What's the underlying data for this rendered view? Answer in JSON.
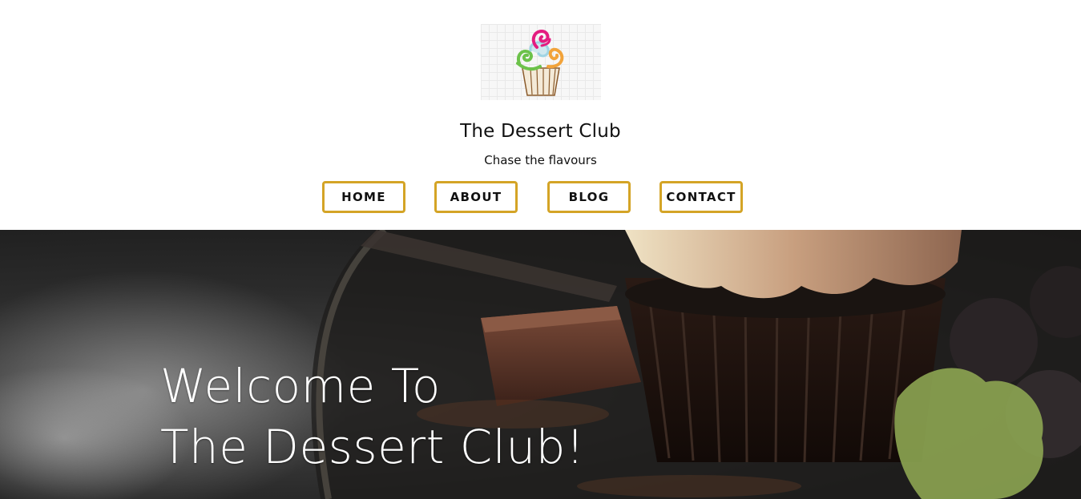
{
  "site": {
    "title": "The Dessert Club",
    "tagline": "Chase the flavours"
  },
  "logo": {
    "icon": "cupcake-logo-icon"
  },
  "nav": {
    "items": [
      {
        "label": "HOME"
      },
      {
        "label": "ABOUT"
      },
      {
        "label": "BLOG"
      },
      {
        "label": "CONTACT"
      }
    ]
  },
  "hero": {
    "line1": "Welcome To",
    "line2": "The Dessert Club!"
  },
  "colors": {
    "accent": "#d4a426",
    "text": "#111111",
    "hero_text": "#ffffff"
  }
}
